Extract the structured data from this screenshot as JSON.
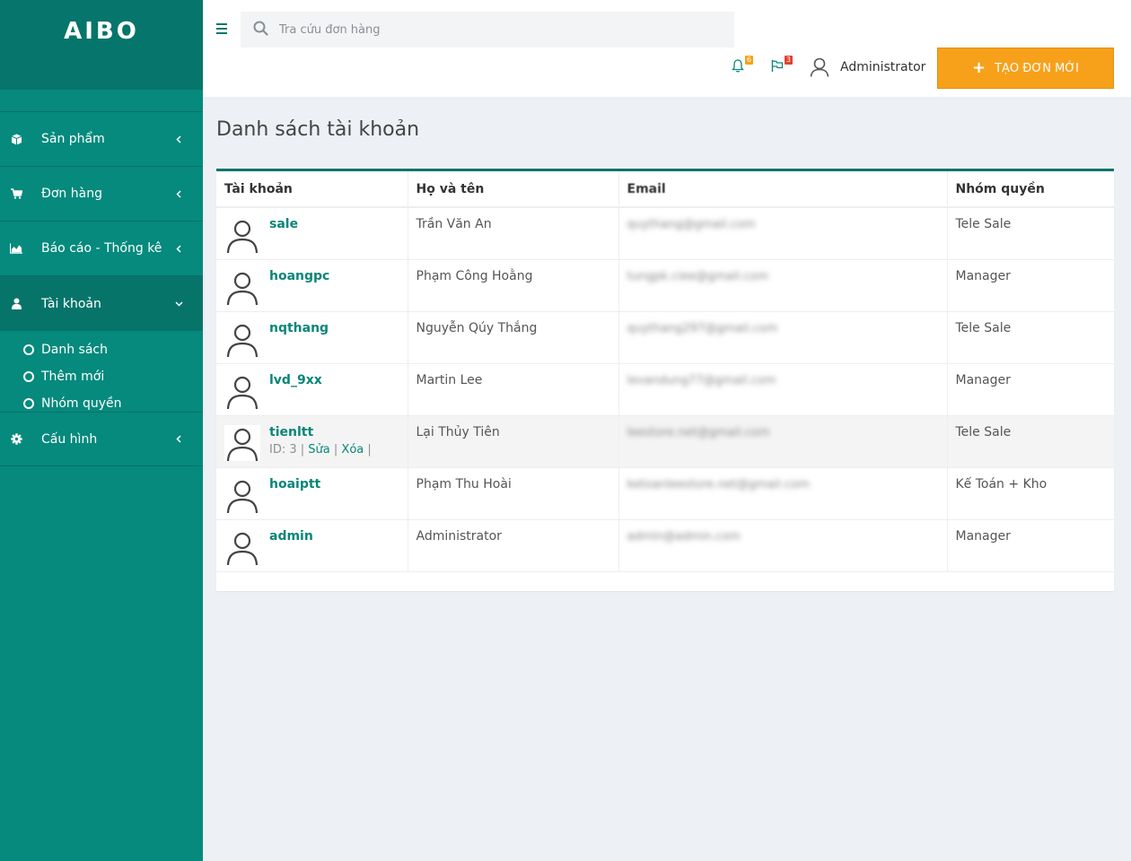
{
  "sidebar": {
    "logo": "AIBO",
    "items": [
      {
        "label": "Sản phẩm",
        "icon": "cube-icon"
      },
      {
        "label": "Đơn hàng",
        "icon": "cart-icon"
      },
      {
        "label": "Báo cáo - Thống kê",
        "icon": "area-chart-icon"
      },
      {
        "label": "Tài khoản",
        "icon": "user-icon"
      },
      {
        "label": "Cấu hình",
        "icon": "gear-icon"
      }
    ],
    "submenu": [
      {
        "label": "Danh sách"
      },
      {
        "label": "Thêm mới"
      },
      {
        "label": "Nhóm quyền"
      }
    ]
  },
  "header": {
    "search_placeholder": "Tra cứu đơn hàng",
    "notifications_count": "6",
    "flags_count": "3",
    "user_name": "Administrator",
    "create_label": "TẠO ĐƠN MỚI"
  },
  "main": {
    "title": "Danh sách tài khoản",
    "columns": [
      "Tài khoản",
      "Họ và tên",
      "Email",
      "Nhóm quyền"
    ],
    "rows": [
      {
        "username": "sale",
        "fullname": "Trần Văn An",
        "email": "quythang@gmail.com",
        "group": "Tele Sale"
      },
      {
        "username": "hoangpc",
        "fullname": "Phạm Công Hoằng",
        "email": "tungpk.ciee@gmail.com",
        "group": "Manager"
      },
      {
        "username": "nqthang",
        "fullname": "Nguyễn Qúy Thắng",
        "email": "quythang297@gmail.com",
        "group": "Tele Sale"
      },
      {
        "username": "lvd_9xx",
        "fullname": "Martin Lee",
        "email": "levandung77@gmail.com",
        "group": "Manager"
      },
      {
        "username": "tienltt",
        "fullname": "Lại Thủy Tiên",
        "email": "leestore.net@gmail.com",
        "group": "Tele Sale",
        "id_text": "ID: 3",
        "edit": "Sửa",
        "delete": "Xóa"
      },
      {
        "username": "hoaiptt",
        "fullname": "Phạm Thu Hoài",
        "email": "ketoanleestore.net@gmail.com",
        "group": "Kế Toán + Kho"
      },
      {
        "username": "admin",
        "fullname": "Administrator",
        "email": "admin@admin.com",
        "group": "Manager"
      }
    ]
  },
  "colors": {
    "sidebar": "#058a7d",
    "accent": "#f7a11a",
    "link": "#0a8679"
  }
}
